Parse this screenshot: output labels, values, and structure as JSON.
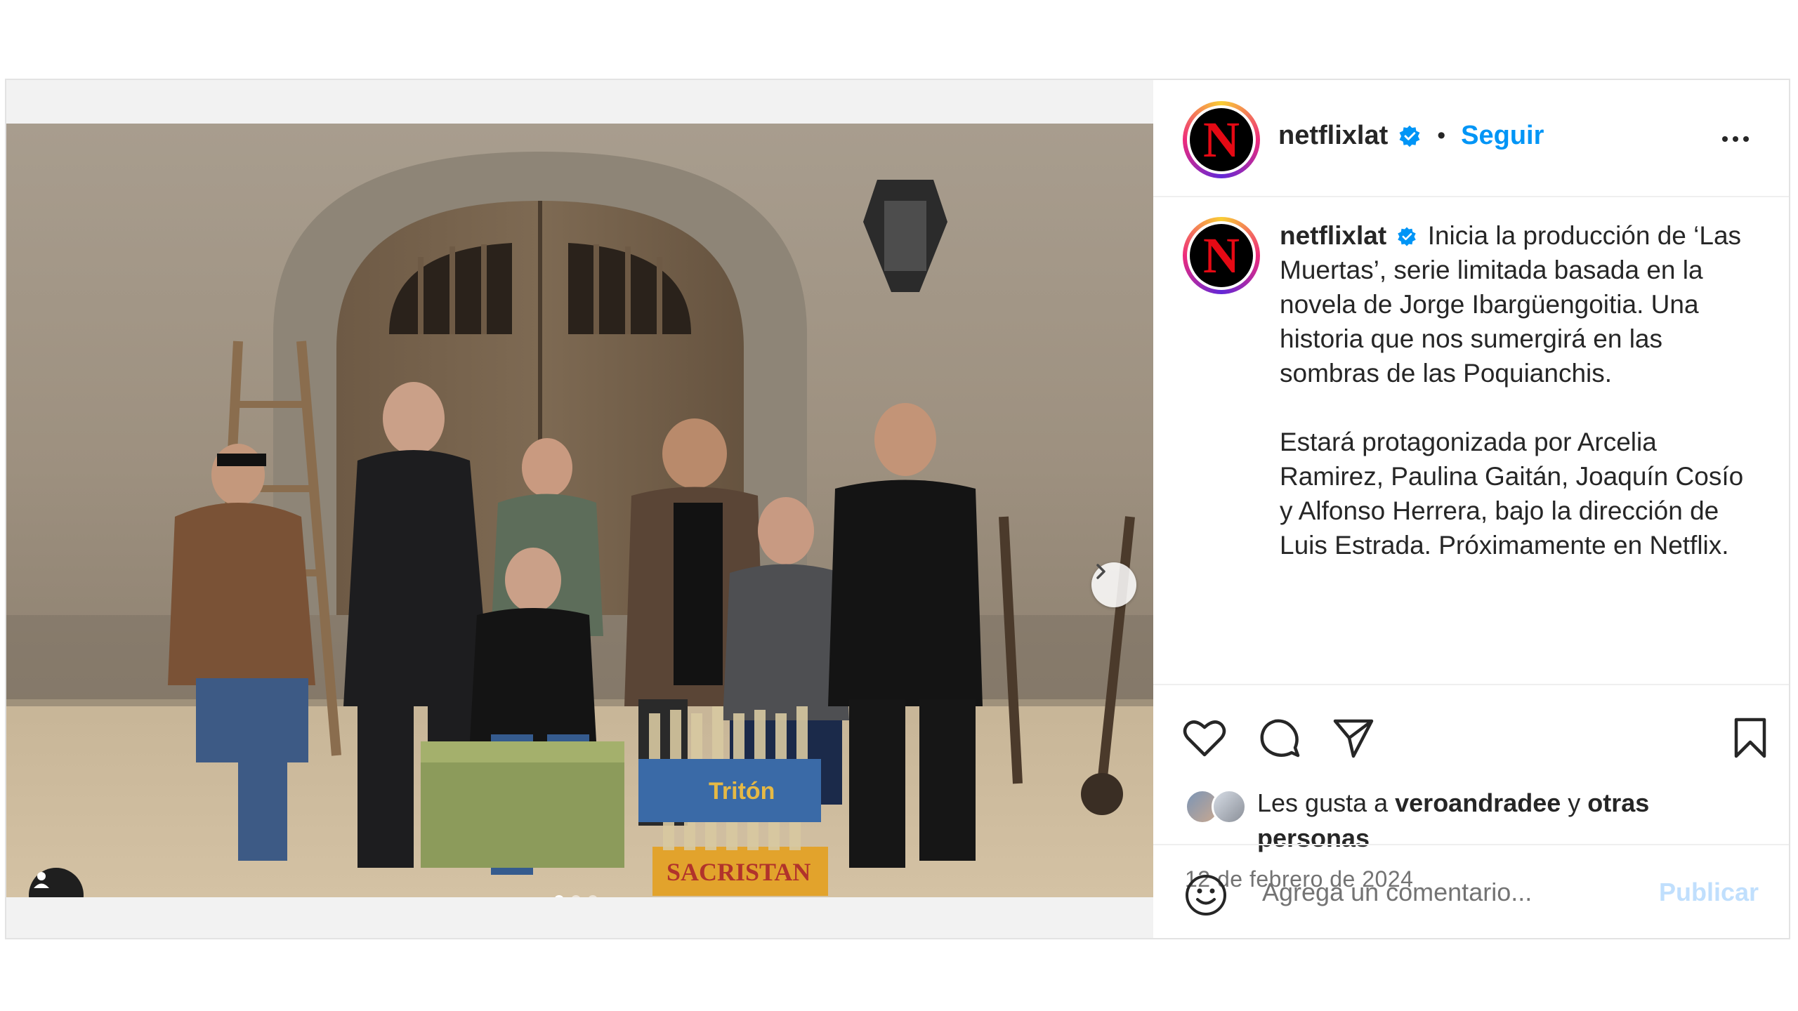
{
  "post": {
    "author": "netflixlat",
    "follow_label": "Seguir",
    "separator": "•",
    "avatar_letter": "N",
    "caption_p1": "Inicia la producción de ‘Las Muertas’, serie limitada basada en la novela de Jorge Ibargüengoitia. Una historia que nos sumergirá en las sombras de las Poquianchis.",
    "caption_p2": "Estará protagonizada por Arcelia Ramirez, Paulina Gaitán, Joaquín Cosío y Alfonso Herrera, bajo la dirección de Luis Estrada. Próximamente en Netflix.",
    "likes_prefix": "Les gusta a ",
    "likes_user": "veroandradee",
    "likes_join": " y ",
    "likes_others": "otras personas",
    "date": "12 de febrero de 2024",
    "comment_placeholder": "Agrega un comentario...",
    "publish_label": "Publicar"
  },
  "media": {
    "carousel_count": 3,
    "carousel_active_index": 0,
    "props_label_1": "Tritón",
    "props_label_2": "SACRISTAN"
  },
  "colors": {
    "accent": "#0095f6",
    "brand_red": "#e50914",
    "publish_disabled": "#c0dffd"
  },
  "icons": [
    "verified-badge-icon",
    "more-options-icon",
    "heart-icon",
    "comment-icon",
    "share-icon",
    "bookmark-icon",
    "emoji-icon",
    "chevron-right-icon",
    "user-tag-icon"
  ]
}
